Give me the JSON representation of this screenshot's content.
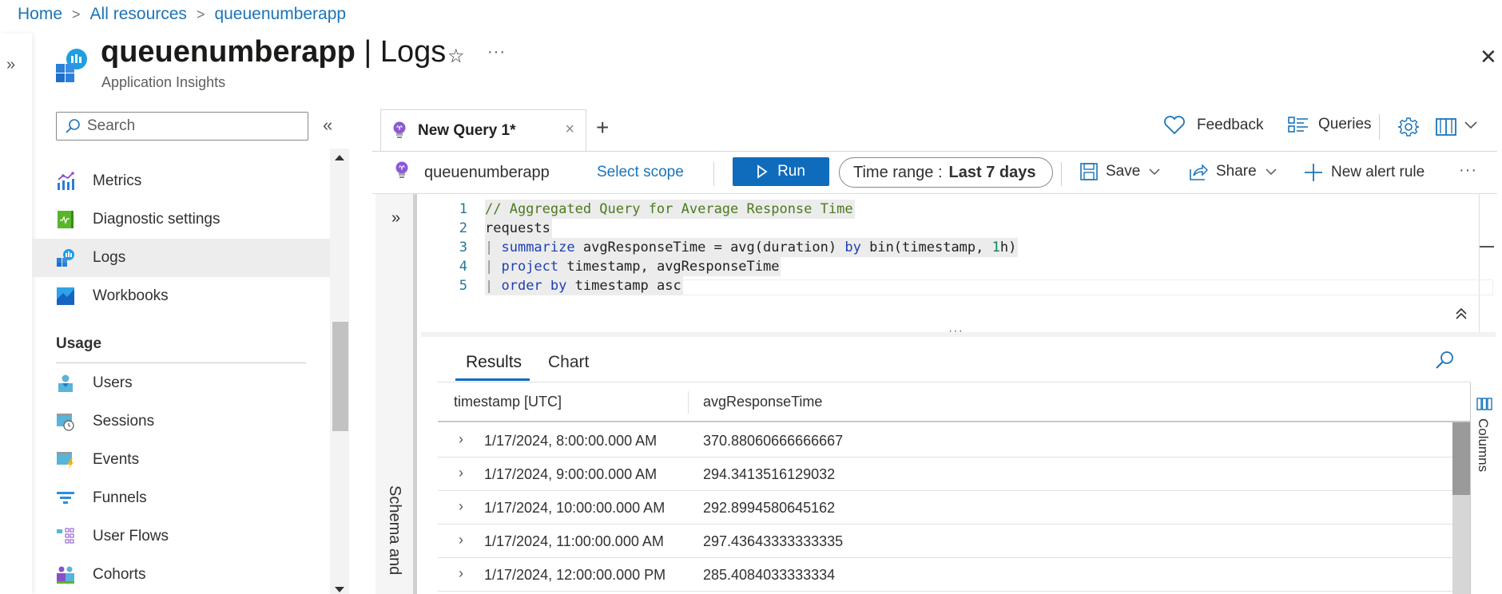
{
  "breadcrumb": [
    {
      "label": "Home"
    },
    {
      "label": "All resources"
    },
    {
      "label": "queuenumberapp"
    }
  ],
  "header": {
    "resource_name": "queuenumberapp",
    "separator": " | ",
    "blade_name": "Logs",
    "subtitle": "Application Insights",
    "star_glyph": "☆",
    "more_glyph": "···",
    "close_glyph": "✕",
    "expand_nav_glyph": "»"
  },
  "sidebar": {
    "search_placeholder": "Search",
    "collapse_glyph": "«",
    "items": [
      {
        "label": "Metrics",
        "icon": "metrics-icon"
      },
      {
        "label": "Diagnostic settings",
        "icon": "diagnostic-settings-icon"
      },
      {
        "label": "Logs",
        "icon": "logs-icon",
        "selected": true
      },
      {
        "label": "Workbooks",
        "icon": "workbooks-icon"
      }
    ],
    "usage_heading": "Usage",
    "usage_items": [
      {
        "label": "Users",
        "icon": "users-icon"
      },
      {
        "label": "Sessions",
        "icon": "sessions-icon"
      },
      {
        "label": "Events",
        "icon": "events-icon"
      },
      {
        "label": "Funnels",
        "icon": "funnels-icon"
      },
      {
        "label": "User Flows",
        "icon": "user-flows-icon"
      },
      {
        "label": "Cohorts",
        "icon": "cohorts-icon"
      }
    ]
  },
  "query_tabs": {
    "active_tab": "New Query 1*",
    "close_glyph": "×",
    "add_glyph": "+"
  },
  "top_actions": {
    "feedback": "Feedback",
    "queries": "Queries"
  },
  "scope_bar": {
    "scope_name": "queuenumberapp",
    "select_scope": "Select scope",
    "run": "Run",
    "time_range_label": "Time range : ",
    "time_range_value": "Last 7 days",
    "save": "Save",
    "share": "Share",
    "new_alert_rule": "New alert rule",
    "more_glyph": "···"
  },
  "schema_panel": {
    "label": "Schema and",
    "expand_glyph": "»"
  },
  "editor": {
    "lines": [
      {
        "no": "1",
        "parts": [
          {
            "t": "// Aggregated Query for Average Response Time",
            "c": "comment"
          }
        ]
      },
      {
        "no": "2",
        "parts": [
          {
            "t": "requests",
            "c": "plain"
          }
        ]
      },
      {
        "no": "3",
        "parts": [
          {
            "t": "| ",
            "c": "pipe"
          },
          {
            "t": "summarize",
            "c": "kw"
          },
          {
            "t": " avgResponseTime = avg(duration) ",
            "c": "plain"
          },
          {
            "t": "by",
            "c": "kw"
          },
          {
            "t": " bin(timestamp, ",
            "c": "plain"
          },
          {
            "t": "1",
            "c": "num"
          },
          {
            "t": "h)",
            "c": "plain"
          }
        ]
      },
      {
        "no": "4",
        "parts": [
          {
            "t": "| ",
            "c": "pipe"
          },
          {
            "t": "project",
            "c": "kw"
          },
          {
            "t": " timestamp, avgResponseTime",
            "c": "plain"
          }
        ]
      },
      {
        "no": "5",
        "parts": [
          {
            "t": "| ",
            "c": "pipe"
          },
          {
            "t": "order",
            "c": "kw"
          },
          {
            "t": " ",
            "c": "plain"
          },
          {
            "t": "by",
            "c": "kw"
          },
          {
            "t": " timestamp asc",
            "c": "plain"
          }
        ]
      }
    ],
    "collapse_glyph": "⌃⌃",
    "splitter_glyph": "···"
  },
  "results": {
    "tabs": [
      "Results",
      "Chart"
    ],
    "active_tab": "Results",
    "columns": [
      "timestamp [UTC]",
      "avgResponseTime"
    ],
    "rows": [
      [
        "1/17/2024, 8:00:00.000 AM",
        "370.88060666666667"
      ],
      [
        "1/17/2024, 9:00:00.000 AM",
        "294.3413516129032"
      ],
      [
        "1/17/2024, 10:00:00.000 AM",
        "292.8994580645162"
      ],
      [
        "1/17/2024, 11:00:00.000 AM",
        "297.43643333333335"
      ],
      [
        "1/17/2024, 12:00:00.000 PM",
        "285.4084033333334"
      ]
    ],
    "columns_pane_label": "Columns",
    "row_expand_glyph": "›"
  },
  "colors": {
    "accent": "#0f6cbd",
    "link": "#1b74b8",
    "selected_nav_bg": "#ededed"
  }
}
